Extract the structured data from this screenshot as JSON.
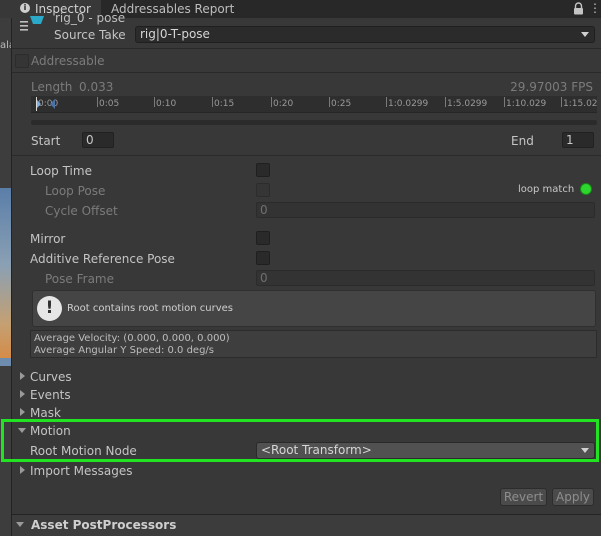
{
  "tabs": {
    "inspector": "Inspector",
    "addressables": "Addressables Report"
  },
  "scene_strip": {
    "cut_text": "ala"
  },
  "header": {
    "take_name_partial": "rig_0 - pose",
    "source_take_label": "Source Take",
    "source_take_value": "rig|0-T-pose",
    "addressable_label": "Addressable"
  },
  "clip": {
    "length_label": "Length",
    "length_value": "0.033",
    "fps": "29.97003 FPS",
    "timeline_ticks": [
      "0:00",
      "0:05",
      "0:10",
      "0:15",
      "0:20",
      "0:25",
      "1:0.0299",
      "1:5.0299",
      "1:10.029",
      "1:15.029"
    ],
    "start_label": "Start",
    "start_value": "0",
    "end_label": "End",
    "end_value": "1"
  },
  "loop": {
    "loop_time": "Loop Time",
    "loop_pose": "Loop Pose",
    "loop_match": "loop match",
    "cycle_offset": "Cycle Offset",
    "cycle_offset_value": "0"
  },
  "mirror": {
    "mirror": "Mirror",
    "additive": "Additive Reference Pose",
    "pose_frame": "Pose Frame",
    "pose_frame_value": "0"
  },
  "help": {
    "root_motion": "Root contains root motion curves",
    "avg_velocity": "Average Velocity: (0.000, 0.000, 0.000)",
    "avg_angular": "Average Angular Y Speed: 0.0 deg/s"
  },
  "sections": {
    "curves": "Curves",
    "events": "Events",
    "mask": "Mask",
    "motion": "Motion",
    "root_motion_node": "Root Motion Node",
    "root_motion_value": "<Root Transform>",
    "import_messages": "Import Messages"
  },
  "buttons": {
    "revert": "Revert",
    "apply": "Apply"
  },
  "footer": {
    "asset_postprocessors": "Asset PostProcessors"
  },
  "colors": {
    "highlight": "#21e321",
    "loop_match": "#2fd52f"
  }
}
